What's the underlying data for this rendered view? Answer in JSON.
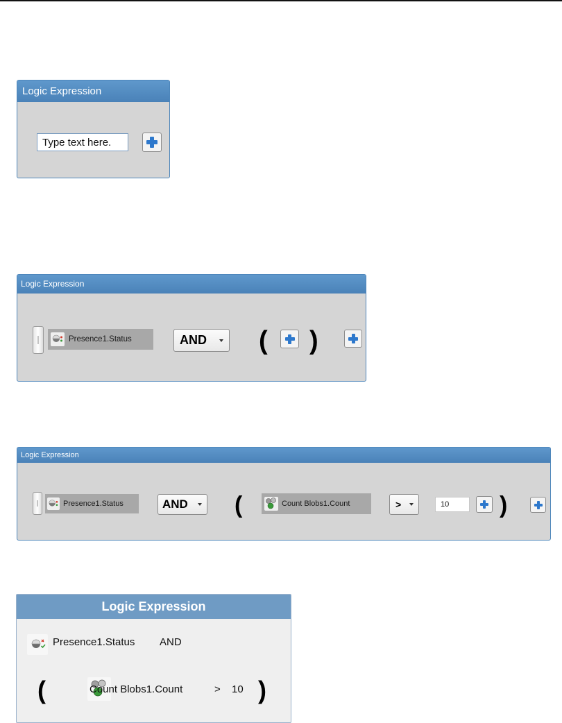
{
  "panel1": {
    "title": "Logic Expression",
    "input_placeholder": "Type text here.",
    "add_icon": "plus-icon"
  },
  "panel2": {
    "title": "Logic Expression",
    "term1": {
      "label": "Presence1.Status",
      "icon": "presence-sensor-icon"
    },
    "operator": "AND",
    "open_paren": "(",
    "close_paren": ")",
    "add_icon": "plus-icon"
  },
  "panel3": {
    "title": "Logic Expression",
    "term1": {
      "label": "Presence1.Status",
      "icon": "presence-sensor-icon"
    },
    "operator": "AND",
    "open_paren": "(",
    "term2": {
      "label": "Count Blobs1.Count",
      "icon": "count-blobs-icon"
    },
    "comparison": ">",
    "value": "10",
    "close_paren": ")",
    "add_icon": "plus-icon"
  },
  "panel4": {
    "title": "Logic Expression",
    "term1": {
      "label": "Presence1.Status",
      "icon": "presence-sensor-icon"
    },
    "operator": "AND",
    "open_paren": "(",
    "term2": {
      "label": "Count Blobs1.Count",
      "icon": "count-blobs-icon"
    },
    "comparison": ">",
    "value": "10",
    "close_paren": ")"
  },
  "colors": {
    "header_blue": "#4a82b8",
    "panel_gray": "#d5d5d5",
    "token_gray": "#a8a8a8",
    "plus_blue": "#2d78cc",
    "status_red": "#d23a2a",
    "status_green": "#3a9a3a"
  }
}
